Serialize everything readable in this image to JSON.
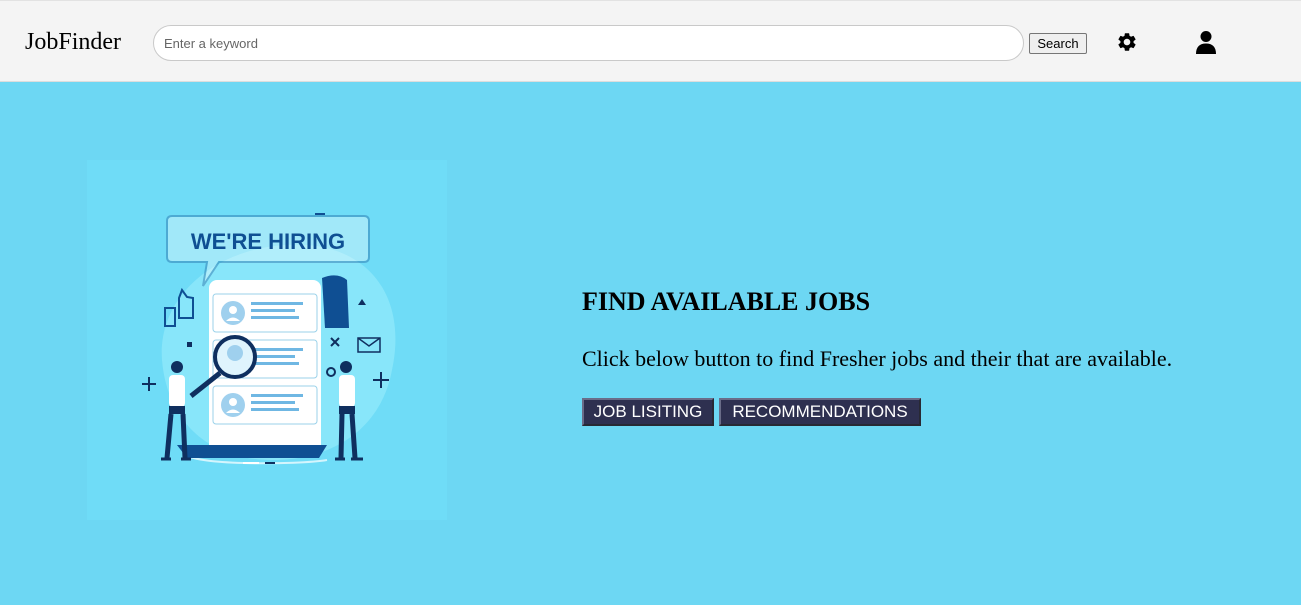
{
  "header": {
    "brand": "JobFinder",
    "search_placeholder": "Enter a keyword",
    "search_value": "",
    "search_button": "Search",
    "settings_icon": "gear-icon",
    "profile_icon": "user-icon"
  },
  "hero": {
    "illustration": {
      "banner_text": "WE'RE HIRING",
      "icon": "hiring-illustration"
    },
    "heading": "FIND AVAILABLE JOBS",
    "description": "Click below button to find Fresher jobs and their that are available.",
    "buttons": {
      "job_listing": "JOB LISITING",
      "recommendations": "RECOMMENDATIONS"
    }
  },
  "colors": {
    "hero_background": "#6dd7f3",
    "navbar_background": "#f4f4f4",
    "button_background": "#2e3050",
    "illustration_navy": "#0f4f93"
  }
}
